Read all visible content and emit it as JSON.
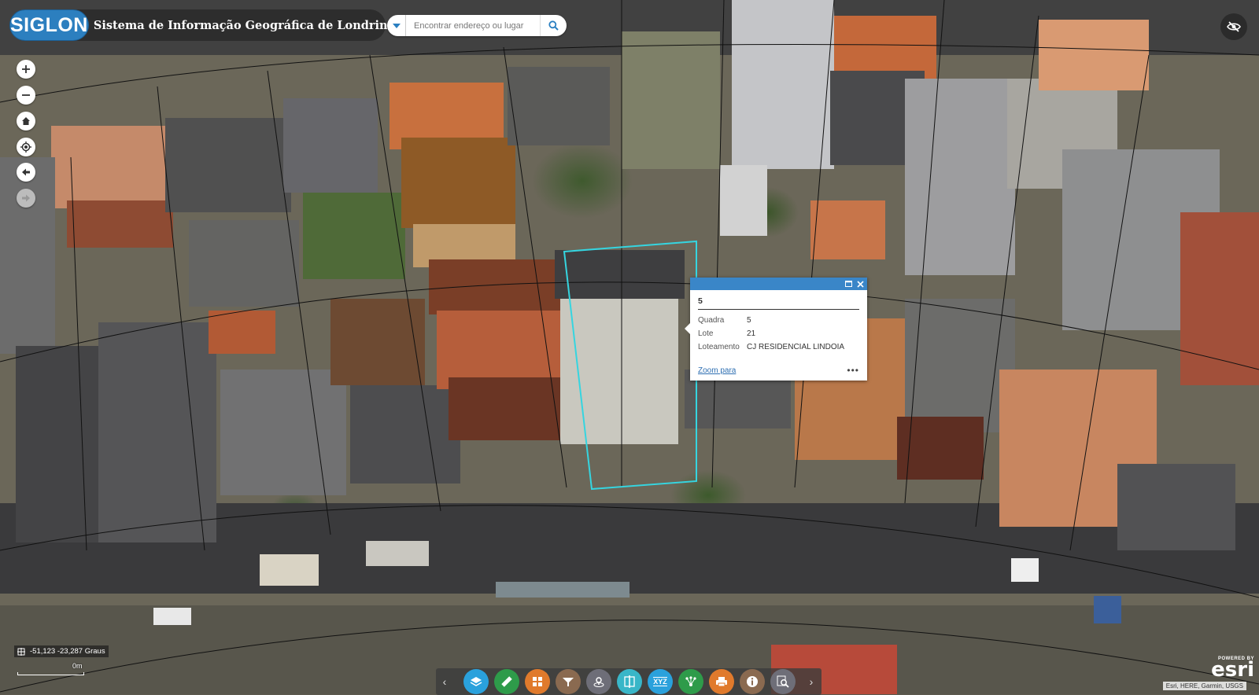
{
  "header": {
    "logo_text": "SIGLON",
    "title": "Sistema de Informação Geográfica de Londrina"
  },
  "search": {
    "placeholder": "Encontrar endereço ou lugar"
  },
  "map_controls": [
    "zoom-in-icon",
    "zoom-out-icon",
    "home-icon",
    "locate-icon",
    "back-icon",
    "forward-icon"
  ],
  "popup": {
    "title": "5",
    "rows": [
      {
        "label": "Quadra",
        "value": "5"
      },
      {
        "label": "Lote",
        "value": "21"
      },
      {
        "label": "Loteamento",
        "value": "CJ RESIDENCIAL LINDOIA"
      }
    ],
    "zoom_link": "Zoom para",
    "more": "•••"
  },
  "coords": {
    "text": "-51,123 -23,287 Graus"
  },
  "scale": {
    "label": "0m"
  },
  "toolbar": {
    "tools": [
      {
        "name": "layers-tool",
        "color": "#2aa1dc"
      },
      {
        "name": "measure-tool",
        "color": "#2e9b4a"
      },
      {
        "name": "gallery-tool",
        "color": "#e07a2c"
      },
      {
        "name": "filter-tool",
        "color": "#8a6a50"
      },
      {
        "name": "location-tool",
        "color": "#6e6e78"
      },
      {
        "name": "swipe-tool",
        "color": "#39b6c8"
      },
      {
        "name": "xyz-tool",
        "color": "#2aa1dc"
      },
      {
        "name": "share-tool",
        "color": "#2e9b4a"
      },
      {
        "name": "print-tool",
        "color": "#e07a2c"
      },
      {
        "name": "about-tool",
        "color": "#8a6a50"
      },
      {
        "name": "query-tool",
        "color": "#6e6e78"
      }
    ],
    "xyz_label": "XYZ"
  },
  "attribution": "Esri, HERE, Garmin, USGS",
  "esri_logo": {
    "small": "POWERED BY",
    "big": "esri"
  },
  "colors": {
    "brand": "#2c7fbf",
    "popup_header": "#3a86c8",
    "selection": "#35d5e0"
  }
}
